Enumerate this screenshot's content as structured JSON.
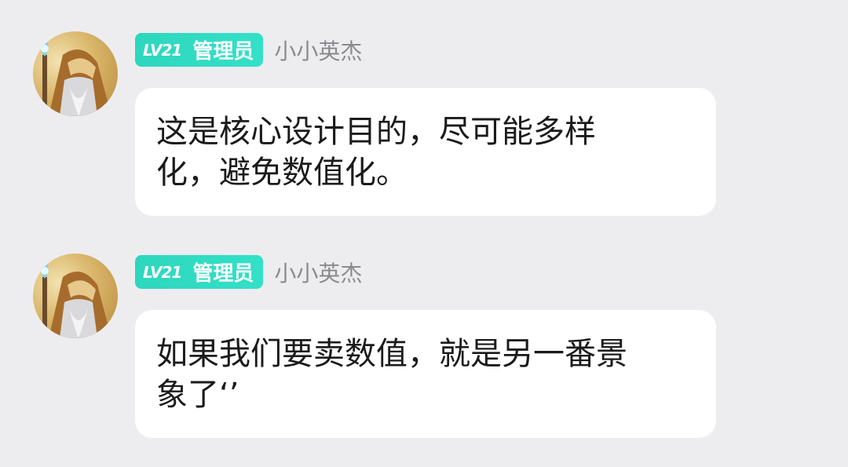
{
  "messages": [
    {
      "level": "LV21",
      "role": "管理员",
      "username": "小小英杰",
      "text": "这是核心设计目的，尽可能多样\n化，避免数值化。"
    },
    {
      "level": "LV21",
      "role": "管理员",
      "username": "小小英杰",
      "text": "如果我们要卖数值，就是另一番景\n象了‘’"
    }
  ],
  "colors": {
    "background": "#ededf0",
    "badge": "#2dd7bd",
    "bubble": "#ffffff",
    "username": "#8a8a8e",
    "text": "#1b1b1b"
  }
}
